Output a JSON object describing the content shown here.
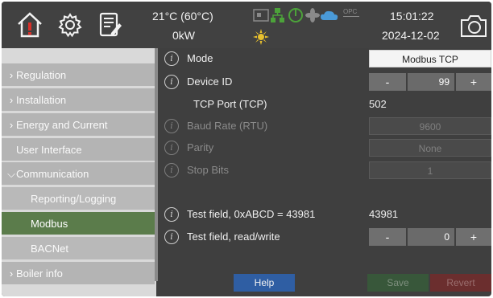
{
  "header": {
    "temperature": "21°C (60°C)",
    "power": "0kW",
    "time": "15:01:22",
    "date": "2024-12-02",
    "icons": [
      "home-alarm-icon",
      "gear-icon",
      "report-edit-icon",
      "plc-icon",
      "network-icon",
      "power-icon",
      "fan-icon",
      "cloud-icon",
      "opc-icon",
      "sun-icon",
      "camera-icon"
    ],
    "opc_label": "OPC"
  },
  "sidebar": {
    "items": [
      {
        "label": "Regulation",
        "chevron": "›"
      },
      {
        "label": "Installation",
        "chevron": "›"
      },
      {
        "label": "Energy and Current",
        "chevron": "›"
      },
      {
        "label": "User Interface",
        "chevron": ""
      },
      {
        "label": "Communication",
        "chevron": "⌵"
      },
      {
        "label": "Reporting/Logging",
        "chevron": ""
      },
      {
        "label": "Modbus",
        "chevron": ""
      },
      {
        "label": "BACNet",
        "chevron": ""
      },
      {
        "label": "Boiler info",
        "chevron": "›"
      }
    ]
  },
  "settings": {
    "mode": {
      "label": "Mode",
      "value": "Modbus TCP"
    },
    "device_id": {
      "label": "Device ID",
      "value": "99",
      "minus": "-",
      "plus": "+"
    },
    "tcp_port": {
      "label": "TCP Port (TCP)",
      "value": "502"
    },
    "baud_rate": {
      "label": "Baud Rate (RTU)",
      "value": "9600"
    },
    "parity": {
      "label": "Parity",
      "value": "None"
    },
    "stop_bits": {
      "label": "Stop Bits",
      "value": "1"
    },
    "test_field": {
      "label": "Test field, 0xABCD = 43981",
      "value": "43981"
    },
    "test_rw": {
      "label": "Test field, read/write",
      "value": "0",
      "minus": "-",
      "plus": "+"
    },
    "info_glyph": "i"
  },
  "footer": {
    "help": "Help",
    "save": "Save",
    "revert": "Revert"
  },
  "colors": {
    "background": "#3f3f3f",
    "sidebar": "#b4b4b4",
    "active_item": "#5b7c4b",
    "help_button": "#2f5ea3",
    "save_button": "#38573a",
    "revert_button": "#6b2e2e",
    "alarm_red": "#d8302a"
  }
}
